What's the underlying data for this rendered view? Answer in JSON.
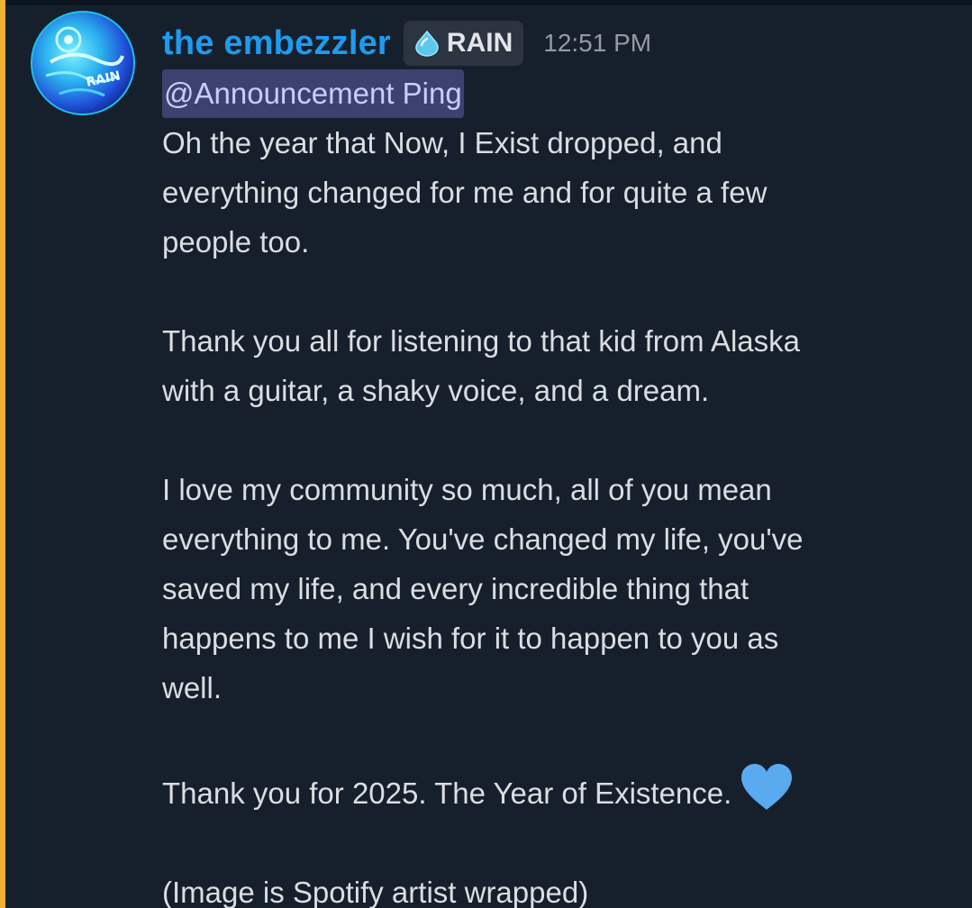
{
  "message": {
    "author": "the embezzler",
    "role_tag": {
      "label": "RAIN",
      "icon": "droplet-icon",
      "icon_color": "#5bc8ec"
    },
    "timestamp": "12:51 PM",
    "avatar_text": "RAIN",
    "mention": "@Announcement Ping",
    "paragraphs": [
      "Oh the year that Now, I Exist dropped, and\neverything changed for me and for quite a few\npeople too.",
      "Thank you all for listening to that kid from Alaska\nwith a guitar, a shaky voice, and a dream.",
      "I love my community so much, all of you mean\neverything to me. You've changed my life, you've\nsaved my life, and every incredible thing that\nhappens to me I wish for it to happen to you as\nwell.",
      "Thank you for 2025. The Year of Existence.",
      "(Image is Spotify artist wrapped)"
    ],
    "emoji": "blue-heart-emoji"
  },
  "colors": {
    "background": "#16202d",
    "username": "#1d9bf0",
    "mention_highlight_bar": "#f0b232",
    "mention_bg": "#3c4270",
    "heart": "#5aaaf0"
  }
}
